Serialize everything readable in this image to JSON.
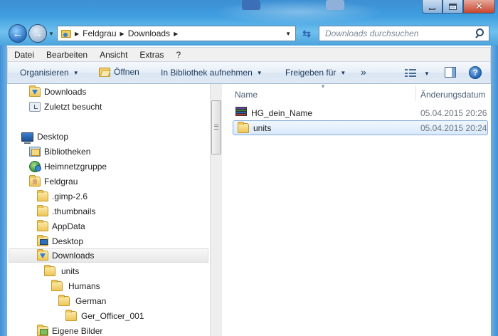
{
  "window": {
    "caption_buttons": [
      "minimize",
      "maximize",
      "close"
    ]
  },
  "address_bar": {
    "crumbs": [
      "Feldgrau",
      "Downloads"
    ]
  },
  "search": {
    "placeholder": "Downloads durchsuchen"
  },
  "menu": [
    "Datei",
    "Bearbeiten",
    "Ansicht",
    "Extras",
    "?"
  ],
  "toolbar": {
    "organize": "Organisieren",
    "open": "Öffnen",
    "include_library": "In Bibliothek aufnehmen",
    "share": "Freigeben für",
    "more": "»"
  },
  "nav": [
    {
      "label": "Downloads",
      "icon": "downloads-folder-icon"
    },
    {
      "label": "Zuletzt besucht",
      "icon": "recent-places-icon"
    },
    {
      "label": "Desktop",
      "icon": "desktop-icon"
    },
    {
      "label": "Bibliotheken",
      "icon": "libraries-icon"
    },
    {
      "label": "Heimnetzgruppe",
      "icon": "homegroup-icon"
    },
    {
      "label": "Feldgrau",
      "icon": "user-folder-icon"
    },
    {
      "label": ".gimp-2.6",
      "icon": "folder-icon"
    },
    {
      "label": ".thumbnails",
      "icon": "folder-icon"
    },
    {
      "label": "AppData",
      "icon": "folder-icon"
    },
    {
      "label": "Desktop",
      "icon": "desktop-folder-icon"
    },
    {
      "label": "Downloads",
      "icon": "downloads-folder-icon",
      "selected": true
    },
    {
      "label": "units",
      "icon": "folder-icon"
    },
    {
      "label": "Humans",
      "icon": "folder-icon"
    },
    {
      "label": "German",
      "icon": "folder-icon"
    },
    {
      "label": "Ger_Officer_001",
      "icon": "folder-icon"
    },
    {
      "label": "Eigene Bilder",
      "icon": "pictures-folder-icon"
    }
  ],
  "file_list": {
    "columns": [
      "Name",
      "Änderungsdatum"
    ],
    "rows": [
      {
        "name": "HG_dein_Name",
        "date": "05.04.2015 20:26",
        "icon": "winrar-archive-icon"
      },
      {
        "name": "units",
        "date": "05.04.2015 20:24",
        "icon": "folder-icon",
        "selected": true
      }
    ]
  },
  "colors": {
    "frame_blue": "#3f9ee0",
    "selection_border": "#84acdd",
    "toolbar_text": "#1e3c5e"
  }
}
